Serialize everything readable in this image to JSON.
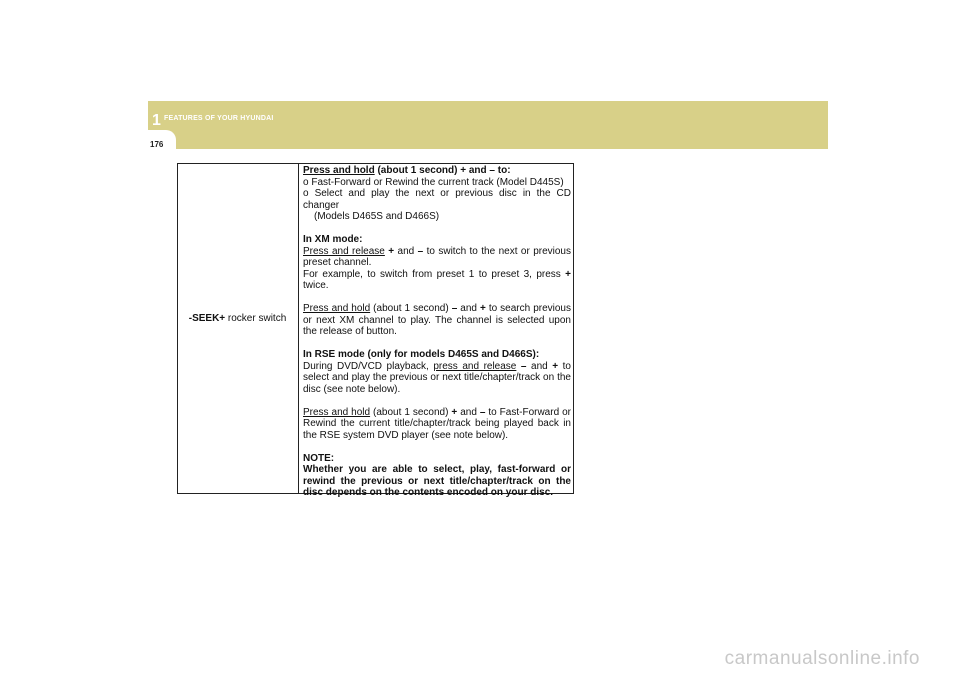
{
  "header": {
    "chapter_number": "1",
    "chapter_title": "FEATURES OF YOUR HYUNDAI",
    "page_number": "176"
  },
  "table": {
    "left_label_control": "-SEEK+",
    "left_label_suffix": " rocker switch",
    "cd": {
      "hold_link": "Press and hold",
      "hold_rest": " (about 1 second) + and – to:",
      "bullet1": "o Fast-Forward or Rewind the current track (Model D445S)",
      "bullet2": "o Select and play the next or previous disc in the CD changer",
      "bullet2_cont": "(Models D465S and D466S)"
    },
    "xm": {
      "heading": "In XM mode:",
      "release_link": "Press and release",
      "plus1": "+",
      "and1": " and ",
      "minus1": "–",
      "release_rest": " to switch to the next or previous preset channel.",
      "example_text": "For example, to switch from preset 1 to preset 3, press ",
      "example_plus": "+",
      "example_end": " twice.",
      "hold_link": "Press and hold",
      "hold_mid": " (about 1 second) ",
      "minus2": "–",
      "and2": " and ",
      "plus2": "+",
      "hold_rest": " to search previous or next XM channel to play.  The channel is selected upon the release of button."
    },
    "rse": {
      "heading": "In RSE mode (only for models D465S and D466S):",
      "playback_text": "During DVD/VCD playback, ",
      "release_link": "press and release",
      "minus1": " –",
      "and1": " and ",
      "plus1": "+",
      "release_rest": " to select and play the previous or next title/chapter/track on the disc (see note below).",
      "hold_link": "Press and hold",
      "hold_mid": " (about 1 second) ",
      "plus2": "+",
      "and2": " and ",
      "minus2": "–",
      "hold_rest": " to Fast-Forward or Rewind the current title/chapter/track being played back in the RSE system DVD player (see note below)."
    },
    "note": {
      "heading": "NOTE:",
      "text": "Whether you are able to select, play, fast-forward or rewind the previous or next title/chapter/track on the disc depends on the contents encoded on your disc."
    }
  },
  "watermark": "carmanualsonline.info",
  "colors": {
    "header_band": "#d8d088",
    "watermark": "#c8c8c8"
  }
}
